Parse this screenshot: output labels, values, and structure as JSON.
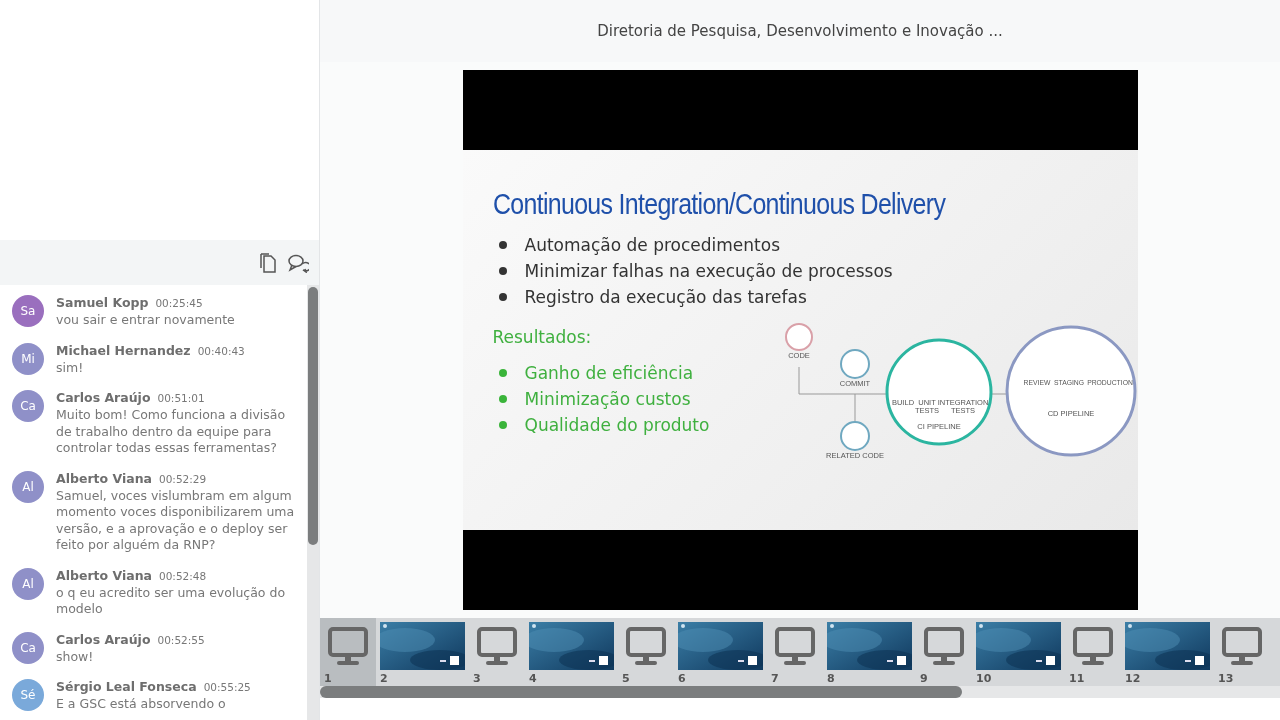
{
  "chat": {
    "messages": [
      {
        "initials": "Sa",
        "color": "#9a6fbe",
        "name": "Samuel Kopp",
        "time": "00:25:45",
        "text": "vou sair e entrar novamente"
      },
      {
        "initials": "Mi",
        "color": "#8f90c8",
        "name": "Michael Hernandez",
        "time": "00:40:43",
        "text": "sim!"
      },
      {
        "initials": "Ca",
        "color": "#8f90c8",
        "name": "Carlos Araújo",
        "time": "00:51:01",
        "text": "Muito bom! Como funciona a divisão de trabalho dentro da equipe para controlar todas essas ferramentas?"
      },
      {
        "initials": "Al",
        "color": "#8f90c8",
        "name": "Alberto Viana",
        "time": "00:52:29",
        "text": "Samuel, voces vislumbram em algum momento voces disponibilizarem uma versão, e a aprovação e o deploy ser feito por alguém da RNP?"
      },
      {
        "initials": "Al",
        "color": "#8f90c8",
        "name": "Alberto Viana",
        "time": "00:52:48",
        "text": "o q eu acredito ser uma evolução do modelo"
      },
      {
        "initials": "Ca",
        "color": "#8f90c8",
        "name": "Carlos Araújo",
        "time": "00:52:55",
        "text": "show!"
      },
      {
        "initials": "Sé",
        "color": "#7aa9da",
        "name": "Sérgio Leal Fonseca",
        "time": "00:55:25",
        "text": "E a GSC está absorvendo o"
      }
    ]
  },
  "header": {
    "title": "Diretoria de Pesquisa, Desenvolvimento e Inovação ..."
  },
  "slide": {
    "title": "Continuous Integration/Continuous Delivery",
    "bullets": [
      "Automação de procedimentos",
      "Minimizar falhas na execução de processos",
      "Registro da execução das tarefas"
    ],
    "results_heading": "Resultados:",
    "results": [
      "Ganho de eficiência",
      "Minimização custos",
      "Qualidade do produto"
    ],
    "diagram": {
      "code": "CODE",
      "commit": "COMMIT",
      "related_code": "RELATED CODE",
      "ci_steps": [
        "BUILD",
        "UNIT TESTS",
        "INTEGRATION TESTS"
      ],
      "ci_label": "CI PIPELINE",
      "cd_steps": [
        "REVIEW",
        "STAGING",
        "PRODUCTION"
      ],
      "cd_label": "CD PIPELINE"
    }
  },
  "thumbnails": [
    {
      "number": "1",
      "kind": "screen",
      "selected": true
    },
    {
      "number": "2",
      "kind": "slide",
      "selected": false
    },
    {
      "number": "3",
      "kind": "screen",
      "selected": false
    },
    {
      "number": "4",
      "kind": "slide",
      "selected": false
    },
    {
      "number": "5",
      "kind": "screen",
      "selected": false
    },
    {
      "number": "6",
      "kind": "slide",
      "selected": false
    },
    {
      "number": "7",
      "kind": "screen",
      "selected": false
    },
    {
      "number": "8",
      "kind": "slide",
      "selected": false
    },
    {
      "number": "9",
      "kind": "screen",
      "selected": false
    },
    {
      "number": "10",
      "kind": "slide",
      "selected": false
    },
    {
      "number": "11",
      "kind": "screen",
      "selected": false
    },
    {
      "number": "12",
      "kind": "slide",
      "selected": false
    },
    {
      "number": "13",
      "kind": "screen",
      "selected": false
    }
  ]
}
